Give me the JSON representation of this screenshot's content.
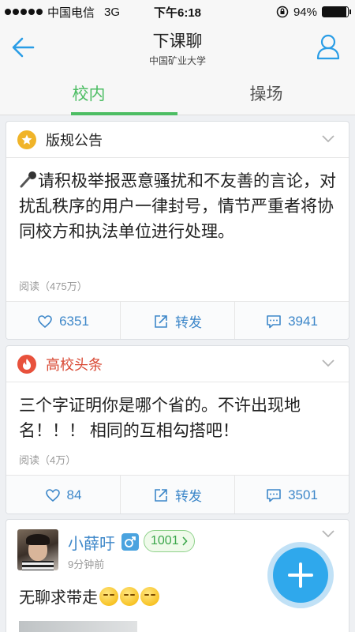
{
  "status_bar": {
    "carrier": "中国电信",
    "network": "3G",
    "time": "下午6:18",
    "battery": "94%",
    "battery_level": 0.94
  },
  "nav": {
    "title": "下课聊",
    "subtitle": "中国矿业大学"
  },
  "tabs": [
    {
      "label": "校内",
      "active": true
    },
    {
      "label": "操场",
      "active": false
    }
  ],
  "posts": [
    {
      "head_title": "版规公告",
      "icon": "star-icon",
      "icon_color": "#f0b429",
      "body": "请积极举报恶意骚扰和不友善的言论，对扰乱秩序的用户一律封号，情节严重者将协同校方和执法单位进行处理。",
      "read_count": "阅读（475万）",
      "likes": "6351",
      "share_label": "转发",
      "comments": "3941"
    },
    {
      "head_title": "高校头条",
      "icon": "flame-icon",
      "icon_color": "#e8513c",
      "body": "三个字证明你是哪个省的。不许出现地名！！！ 相同的互相勾搭吧！",
      "read_count": "阅读（4万）",
      "likes": "84",
      "share_label": "转发",
      "comments": "3501"
    }
  ],
  "user_post": {
    "username": "小薛吁",
    "level": "1001",
    "time": "9分钟前",
    "text": "无聊求带走"
  },
  "colors": {
    "accent_green": "#4cbd63",
    "link_blue": "#3d87c9",
    "fab_blue": "#2fa8ec"
  }
}
